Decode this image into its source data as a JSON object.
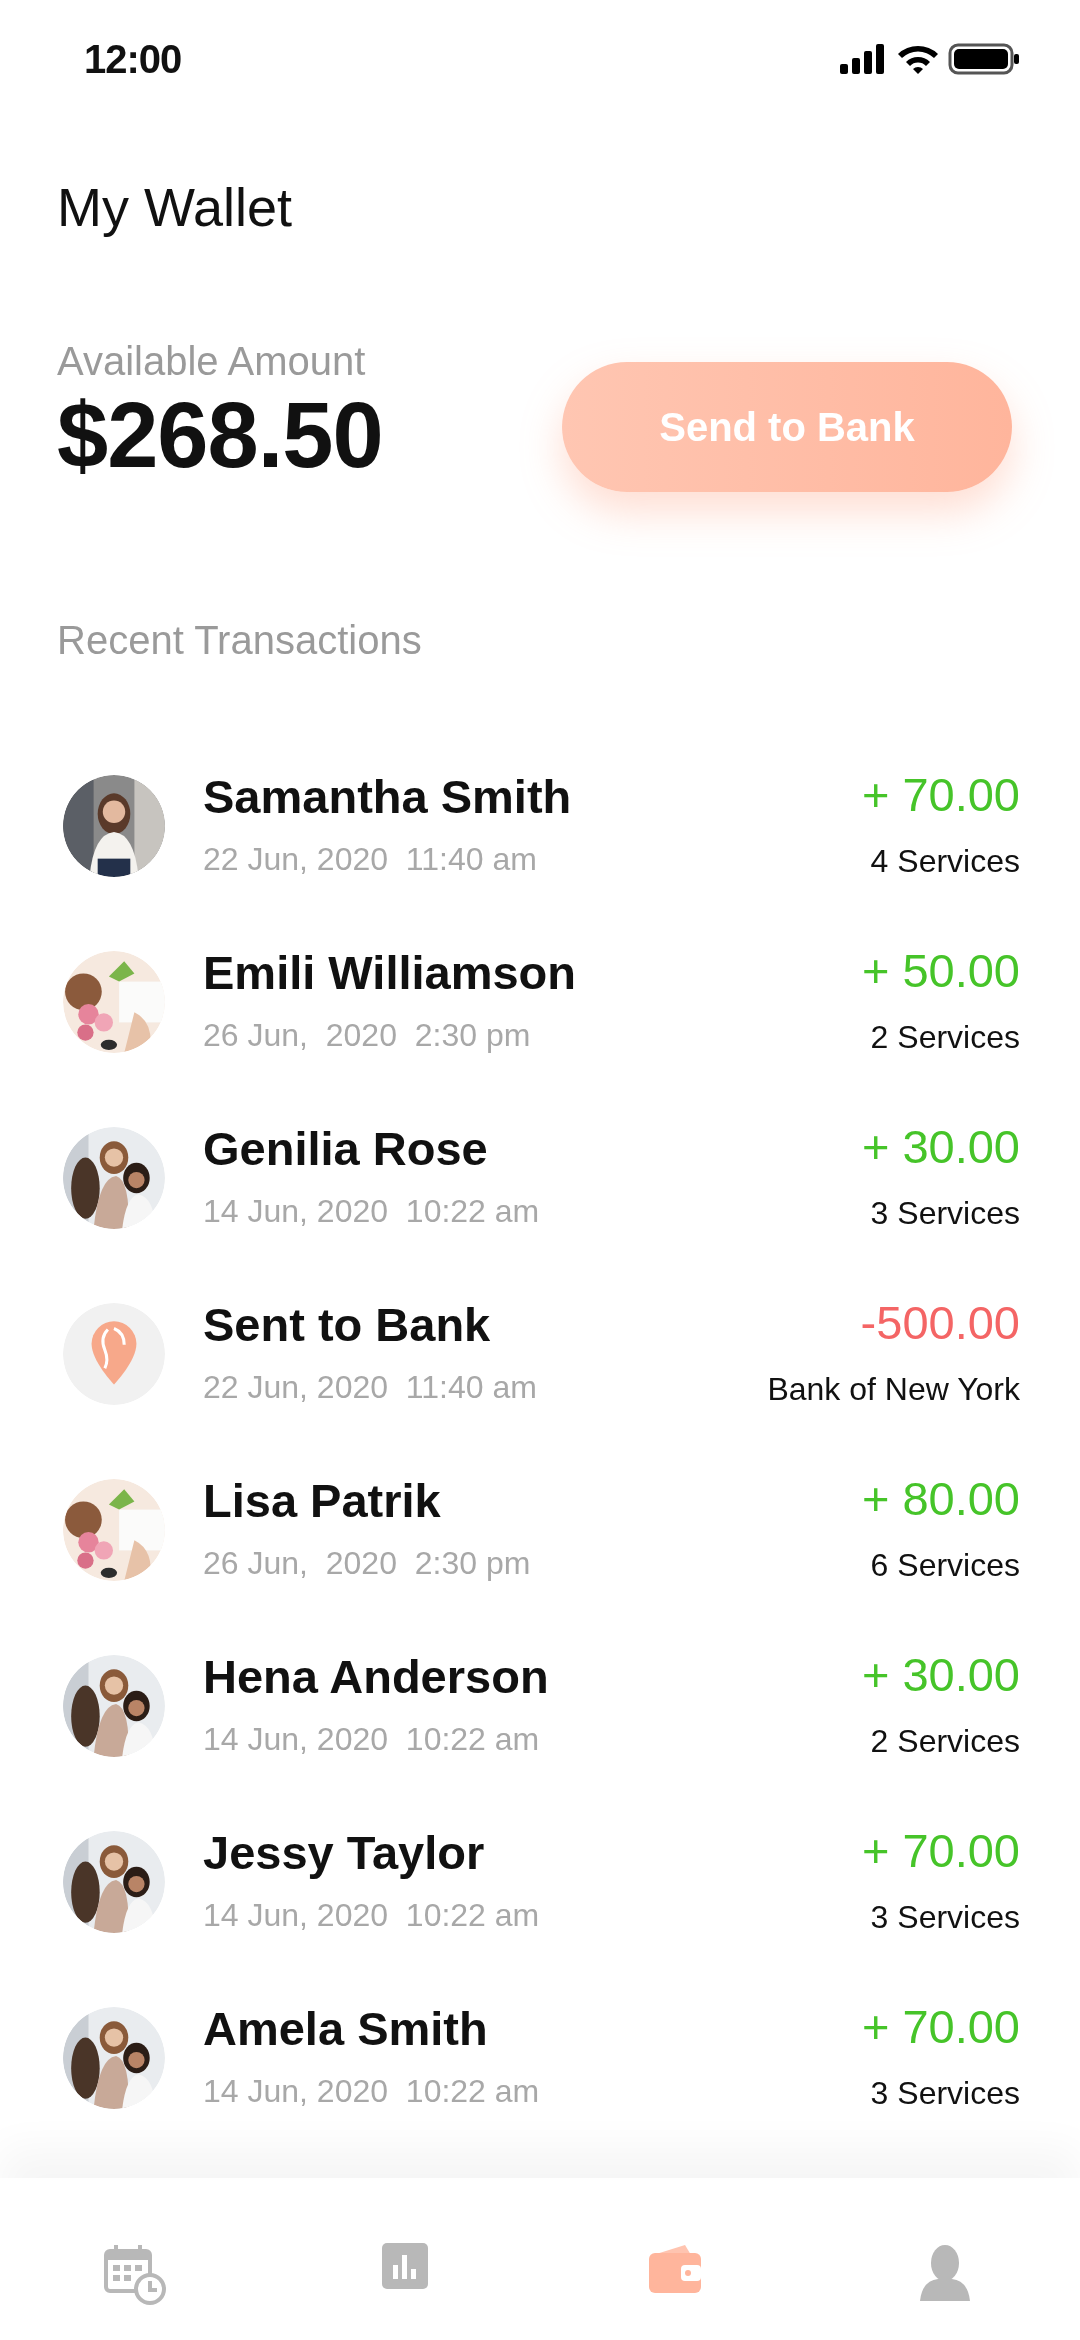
{
  "status_bar": {
    "time": "12:00"
  },
  "title": "My Wallet",
  "balance": {
    "label": "Available Amount",
    "amount": "$268.50"
  },
  "send_button": "Send to Bank",
  "section_title": "Recent Transactions",
  "transactions": [
    {
      "name": "Samantha Smith",
      "date": "22 Jun, 2020  11:40 am",
      "amount": "+ 70.00",
      "detail": "4 Services",
      "kind": "credit"
    },
    {
      "name": "Emili Williamson",
      "date": "26 Jun,  2020  2:30 pm",
      "amount": "+ 50.00",
      "detail": "2 Services",
      "kind": "credit"
    },
    {
      "name": "Genilia Rose",
      "date": "14 Jun, 2020  10:22 am",
      "amount": "+ 30.00",
      "detail": "3 Services",
      "kind": "credit"
    },
    {
      "name": "Sent to Bank",
      "date": "22 Jun, 2020  11:40 am",
      "amount": "-500.00",
      "detail": "Bank of New York",
      "kind": "debit"
    },
    {
      "name": "Lisa Patrik",
      "date": "26 Jun,  2020  2:30 pm",
      "amount": "+ 80.00",
      "detail": "6 Services",
      "kind": "credit"
    },
    {
      "name": "Hena Anderson",
      "date": "14 Jun, 2020  10:22 am",
      "amount": "+ 30.00",
      "detail": "2 Services",
      "kind": "credit"
    },
    {
      "name": "Jessy Taylor",
      "date": "14 Jun, 2020  10:22 am",
      "amount": "+ 70.00",
      "detail": "3 Services",
      "kind": "credit"
    },
    {
      "name": "Amela Smith",
      "date": "14 Jun, 2020  10:22 am",
      "amount": "+ 70.00",
      "detail": "3 Services",
      "kind": "credit"
    }
  ],
  "bottom_nav": [
    {
      "selected": false
    },
    {
      "selected": false
    },
    {
      "selected": true
    },
    {
      "selected": false
    }
  ]
}
